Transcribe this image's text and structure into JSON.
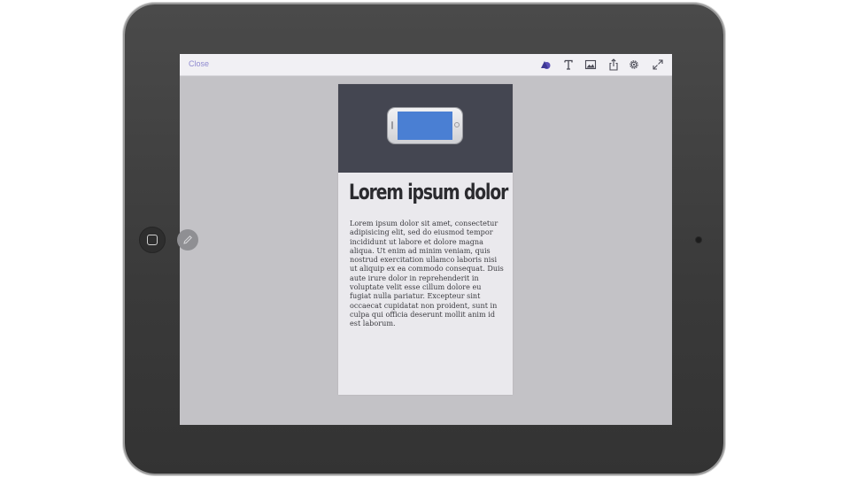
{
  "toolbar": {
    "close_label": "Close",
    "tools": [
      {
        "icon": "shape-icon"
      },
      {
        "icon": "text-icon"
      },
      {
        "icon": "image-icon"
      },
      {
        "icon": "share-icon"
      },
      {
        "icon": "gear-icon"
      },
      {
        "icon": "expand-icon"
      }
    ]
  },
  "card": {
    "title": "Lorem ipsum dolor",
    "body": "Lorem ipsum dolor sit amet, consectetur adipisicing elit, sed do eiusmod tempor incididunt ut labore et dolore magna aliqua. Ut enim ad minim veniam, quis nostrud exercitation ullamco laboris nisi ut aliquip ex ea commodo consequat. Duis aute irure dolor in reprehenderit in voluptate velit esse cillum dolore eu fugiat nulla pariatur. Excepteur sint occaecat cupidatat non proident, sunt in culpa qui officia deserunt mollit anim id est laborum."
  },
  "colors": {
    "accent": "#5a4fb8",
    "close_text": "#8f8ad0",
    "hero_background": "#444651",
    "phone_screen": "#4a7fd3",
    "canvas_background": "#c3c2c6"
  }
}
